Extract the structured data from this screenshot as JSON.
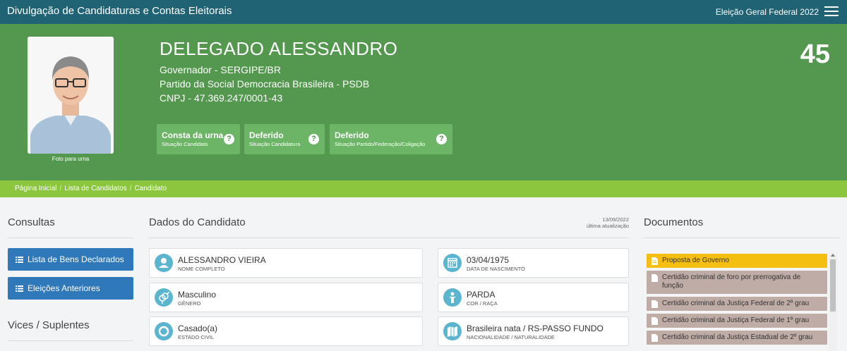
{
  "topbar": {
    "title": "Divulgação de Candidaturas e Contas Eleitorais",
    "election": "Eleição Geral Federal 2022",
    "menu_icon": "hamburger-menu-icon"
  },
  "candidate": {
    "name": "DELEGADO ALESSANDRO",
    "office": "Governador - SERGIPE/BR",
    "party": "Partido da Social Democracia Brasileira - PSDB",
    "cnpj": "CNPJ - 47.369.247/0001-43",
    "number": "45",
    "photo_caption": "Foto para urna"
  },
  "statuses": [
    {
      "title": "Consta da urna",
      "subtitle": "Situação Candidato"
    },
    {
      "title": "Deferido",
      "subtitle": "Situação Candidatura"
    },
    {
      "title": "Deferido",
      "subtitle": "Situação Partido/Federação/Coligação"
    }
  ],
  "breadcrumb": {
    "home": "Página Inicial",
    "list": "Lista de Candidatos",
    "current": "Candidato",
    "separator": "/"
  },
  "left": {
    "consultas_title": "Consultas",
    "bens_button": "Lista de Bens Declarados",
    "eleicoes_button": "Eleições Anteriores",
    "vices_title": "Vices / Suplentes"
  },
  "dados": {
    "title": "Dados do Candidato",
    "updated_date": "13/09/2022",
    "updated_label": "última atualização",
    "cards": [
      {
        "value": "ALESSANDRO VIEIRA",
        "label": "NOME COMPLETO",
        "icon": "user-icon"
      },
      {
        "value": "03/04/1975",
        "label": "DATA DE NASCIMENTO",
        "icon": "calendar-icon"
      },
      {
        "value": "Masculino",
        "label": "GÊNERO",
        "icon": "gender-icon"
      },
      {
        "value": "PARDA",
        "label": "COR / RAÇA",
        "icon": "person-icon"
      },
      {
        "value": "Casado(a)",
        "label": "ESTADO CIVIL",
        "icon": "ring-icon"
      },
      {
        "value": "Brasileira nata / RS-PASSO FUNDO",
        "label": "NACIONALIDADE / NATURALIDADE",
        "icon": "map-icon"
      }
    ]
  },
  "documentos": {
    "title": "Documentos",
    "items": [
      "Proposta de Governo",
      "Certidão criminal de foro por prerrogativa de função",
      "Certidão criminal da Justiça Federal de 2º grau",
      "Certidão criminal da Justiça Federal de 1º grau",
      "Certidão criminal da Justiça Estadual de 2º grau"
    ]
  },
  "colors": {
    "topbar": "#1f6374",
    "header": "#53984e",
    "status_box": "#6db566",
    "breadcrumb": "#8cc63f",
    "button": "#2f78b9",
    "card_icon": "#5bb5cf",
    "doc_active": "#f5bf11",
    "doc_item": "#bfaca6"
  }
}
